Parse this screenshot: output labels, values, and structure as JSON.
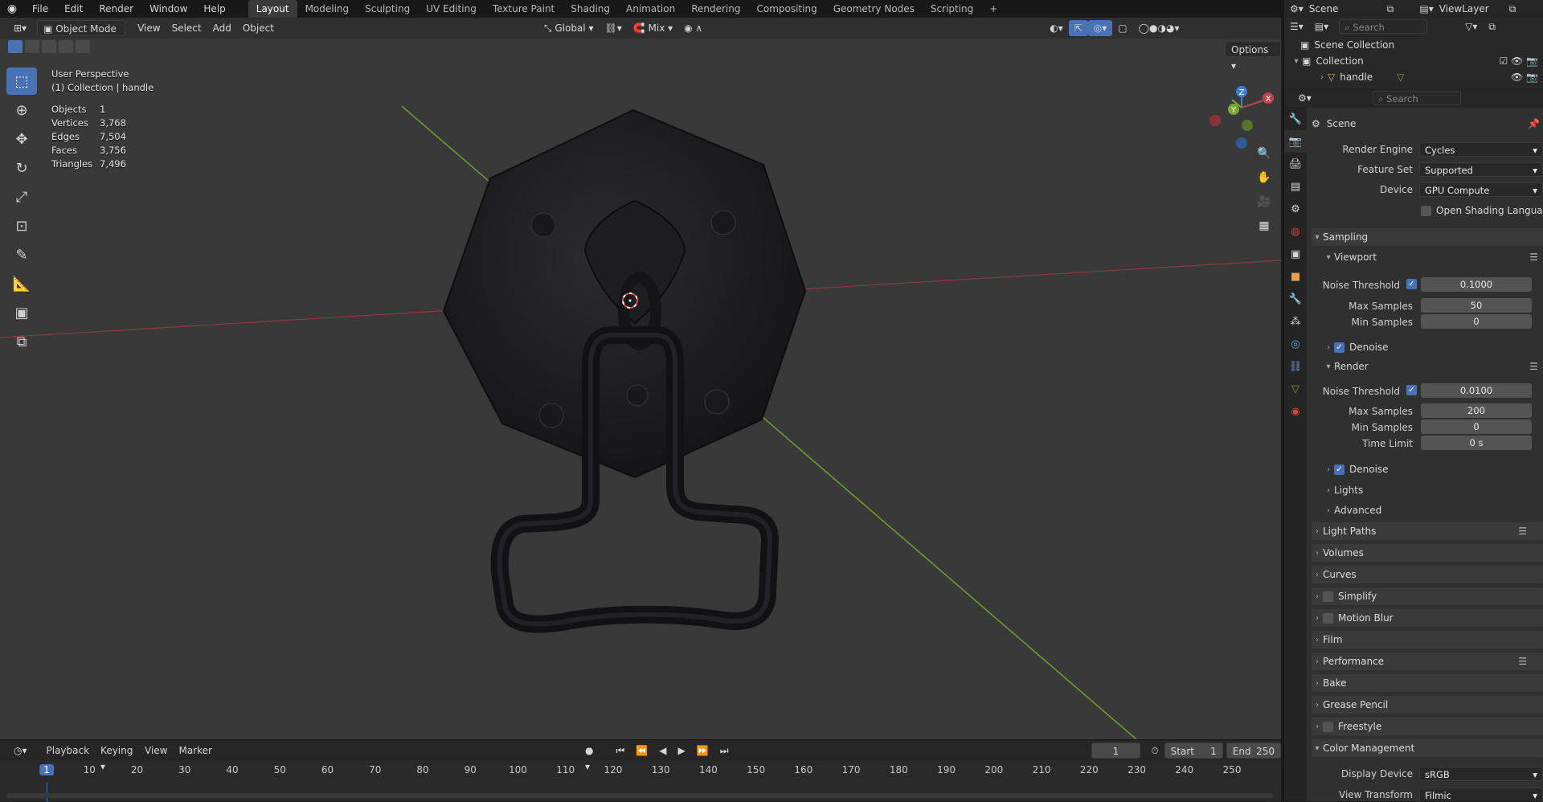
{
  "topbar": {
    "menus": [
      "File",
      "Edit",
      "Render",
      "Window",
      "Help"
    ],
    "workspaces": [
      "Layout",
      "Modeling",
      "Sculpting",
      "UV Editing",
      "Texture Paint",
      "Shading",
      "Animation",
      "Rendering",
      "Compositing",
      "Geometry Nodes",
      "Scripting"
    ],
    "active_workspace": "Layout",
    "add_tab": "+",
    "scene": "Scene",
    "view_layer": "ViewLayer"
  },
  "viewport": {
    "mode": "Object Mode",
    "menus": [
      "View",
      "Select",
      "Add",
      "Object"
    ],
    "transform_orientation": "Global",
    "snap_mode": "Mix",
    "options_label": "Options",
    "view_name": "User Perspective",
    "collection_label": "(1) Collection | handle",
    "stats": [
      {
        "k": "Objects",
        "v": "1"
      },
      {
        "k": "Vertices",
        "v": "3,768"
      },
      {
        "k": "Edges",
        "v": "7,504"
      },
      {
        "k": "Faces",
        "v": "3,756"
      },
      {
        "k": "Triangles",
        "v": "7,496"
      }
    ],
    "gizmo_axes": {
      "x": "X",
      "y": "Y",
      "z": "Z"
    }
  },
  "timeline": {
    "menus": [
      "Playback",
      "Keying",
      "View",
      "Marker"
    ],
    "current_frame": "1",
    "start_label": "Start",
    "start": "1",
    "end_label": "End",
    "end": "250",
    "ticks": [
      "1",
      "10",
      "20",
      "30",
      "40",
      "50",
      "60",
      "70",
      "80",
      "90",
      "100",
      "110",
      "120",
      "130",
      "140",
      "150",
      "160",
      "170",
      "180",
      "190",
      "200",
      "210",
      "220",
      "230",
      "240",
      "250"
    ]
  },
  "outliner": {
    "search_placeholder": "Search",
    "scene_collection": "Scene Collection",
    "collection": "Collection",
    "object": "handle"
  },
  "properties": {
    "search_placeholder": "Search",
    "context": "Scene",
    "render_engine_label": "Render Engine",
    "render_engine": "Cycles",
    "feature_set_label": "Feature Set",
    "feature_set": "Supported",
    "device_label": "Device",
    "device": "GPU Compute",
    "osl_label": "Open Shading Language",
    "sampling": "Sampling",
    "viewport": "Viewport",
    "vp_noise_label": "Noise Threshold",
    "vp_noise": "0.1000",
    "vp_max_label": "Max Samples",
    "vp_max": "50",
    "vp_min_label": "Min Samples",
    "vp_min": "0",
    "vp_denoise": "Denoise",
    "render": "Render",
    "r_noise_label": "Noise Threshold",
    "r_noise": "0.0100",
    "r_max_label": "Max Samples",
    "r_max": "200",
    "r_min_label": "Min Samples",
    "r_min": "0",
    "r_time_label": "Time Limit",
    "r_time": "0 s",
    "r_denoise": "Denoise",
    "lights": "Lights",
    "advanced": "Advanced",
    "light_paths": "Light Paths",
    "volumes": "Volumes",
    "curves": "Curves",
    "simplify": "Simplify",
    "motion_blur": "Motion Blur",
    "film": "Film",
    "performance": "Performance",
    "bake": "Bake",
    "grease_pencil": "Grease Pencil",
    "freestyle": "Freestyle",
    "color_management": "Color Management",
    "display_device_label": "Display Device",
    "display_device": "sRGB",
    "view_transform_label": "View Transform",
    "view_transform": "Filmic"
  },
  "colors": {
    "accent": "#4772b3",
    "x_axis": "#c0444d",
    "y_axis": "#7ba82e",
    "z_axis": "#3f7fd8"
  }
}
